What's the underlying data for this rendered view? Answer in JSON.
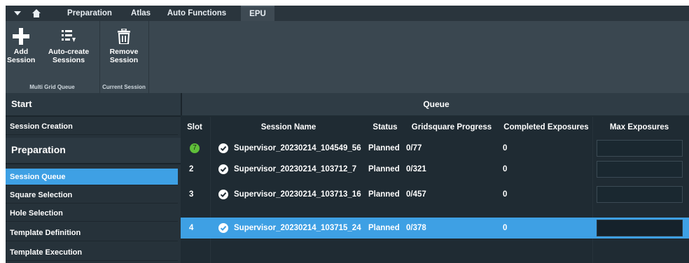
{
  "tabs": [
    "Preparation",
    "Atlas",
    "Auto Functions",
    "EPU"
  ],
  "ribbon": {
    "multi_grid_queue": {
      "label": "Multi Grid Queue",
      "buttons": [
        {
          "label1": "Add",
          "label2": "Session",
          "icon": "plus-icon"
        },
        {
          "label1": "Auto-create",
          "label2": "Sessions",
          "icon": "list-icon"
        }
      ]
    },
    "current_session": {
      "label": "Current Session",
      "buttons": [
        {
          "label1": "Remove",
          "label2": "Session",
          "icon": "trash-icon"
        }
      ]
    }
  },
  "nav": {
    "start": "Start",
    "session_creation": "Session Creation",
    "preparation": "Preparation",
    "items": [
      "Session Queue",
      "Square Selection",
      "Hole Selection",
      "Template Definition",
      "Template Execution"
    ],
    "selected": "Session Queue"
  },
  "queue": {
    "title": "Queue",
    "columns": [
      "Slot",
      "Session Name",
      "Status",
      "Gridsquare Progress",
      "Completed Exposures",
      "Max Exposures"
    ],
    "rows": [
      {
        "slot": "7",
        "name": "Supervisor_20230214_104549_56",
        "status": "Planned",
        "progress": "0/77",
        "completed": "0",
        "max": ""
      },
      {
        "slot": "2",
        "name": "Supervisor_20230214_103712_7",
        "status": "Planned",
        "progress": "0/321",
        "completed": "0",
        "max": ""
      },
      {
        "slot": "3",
        "name": "Supervisor_20230214_103713_16",
        "status": "Planned",
        "progress": "0/457",
        "completed": "0",
        "max": ""
      },
      {
        "slot": "4",
        "name": "Supervisor_20230214_103715_24",
        "status": "Planned",
        "progress": "0/378",
        "completed": "0",
        "max": ""
      }
    ]
  },
  "colors": {
    "accent": "#3ea0e4",
    "slot_badge": "#5fbf3a",
    "background": "#1f2b33"
  }
}
